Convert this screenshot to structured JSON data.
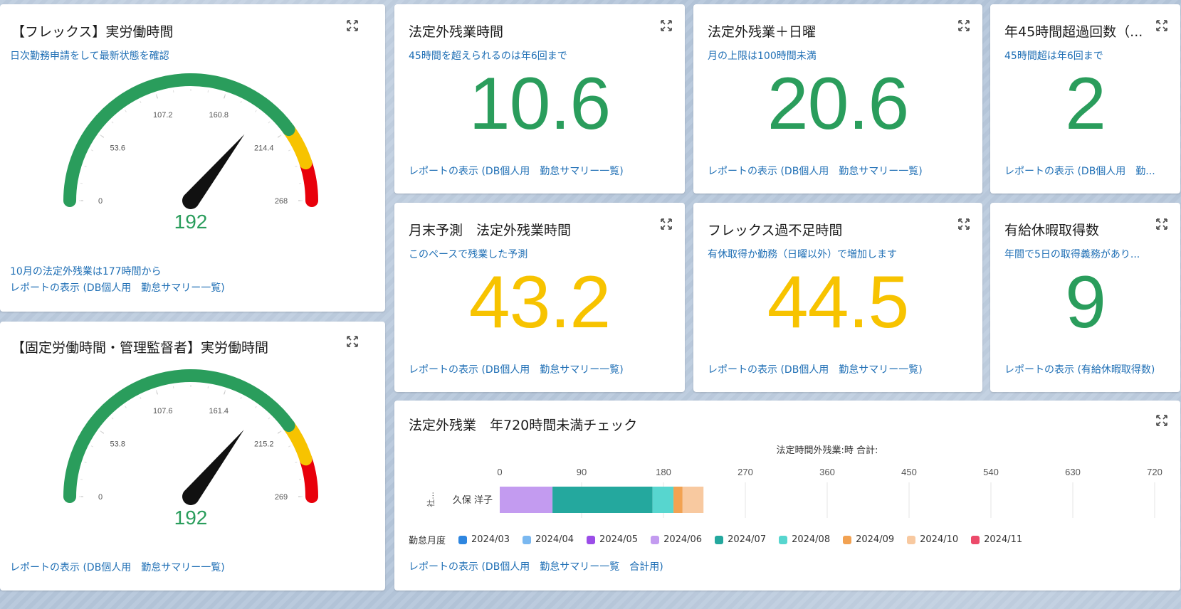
{
  "colors": {
    "green": "#2a9d5c",
    "yellow": "#f7c300",
    "red": "#e8000b",
    "link": "#1f6fb5"
  },
  "gauge1": {
    "title": "【フレックス】実労働時間",
    "subtitle": "日次勤務申請をして最新状態を確認",
    "ticks": [
      "0",
      "53.6",
      "107.2",
      "160.8",
      "214.4",
      "268"
    ],
    "value": "192",
    "value_num": 192,
    "max": 268,
    "yellow_from": 214.4,
    "red_from": 241,
    "note": "10月の法定外残業は177時間から",
    "link": "レポートの表示 (DB個人用　勤怠サマリー一覧)",
    "expand_icon": "expand-icon"
  },
  "gauge2": {
    "title": "【固定労働時間・管理監督者】実労働時間",
    "ticks": [
      "0",
      "53.8",
      "107.6",
      "161.4",
      "215.2",
      "269"
    ],
    "value": "192",
    "value_num": 192,
    "max": 269,
    "yellow_from": 215.2,
    "red_from": 242,
    "link": "レポートの表示 (DB個人用　勤怠サマリー一覧)",
    "expand_icon": "expand-icon"
  },
  "metrics": [
    {
      "title": "法定外残業時間",
      "subtitle": "45時間を超えられるのは年6回まで",
      "value": "10.6",
      "color": "#2a9d5c",
      "link": "レポートの表示 (DB個人用　勤怠サマリー一覧)"
    },
    {
      "title": "法定外残業＋日曜",
      "subtitle": "月の上限は100時間未満",
      "value": "20.6",
      "color": "#2a9d5c",
      "link": "レポートの表示 (DB個人用　勤怠サマリー一覧)"
    },
    {
      "title": "年45時間超過回数（...",
      "subtitle": "45時間超は年6回まで",
      "value": "2",
      "color": "#2a9d5c",
      "link": "レポートの表示 (DB個人用　勤..."
    },
    {
      "title": "月末予測　法定外残業時間",
      "subtitle": "このペースで残業した予測",
      "value": "43.2",
      "color": "#f7c300",
      "link": "レポートの表示 (DB個人用　勤怠サマリー一覧)"
    },
    {
      "title": "フレックス過不足時間",
      "subtitle": "有休取得か勤務（日曜以外）で増加します",
      "value": "44.5",
      "color": "#f7c300",
      "link": "レポートの表示 (DB個人用　勤怠サマリー一覧)"
    },
    {
      "title": "有給休暇取得数",
      "subtitle": "年間で5日の取得義務があり...",
      "value": "9",
      "color": "#2a9d5c",
      "link": "レポートの表示 (有給休暇取得数)"
    }
  ],
  "bar_card": {
    "title": "法定外残業　年720時間未満チェック",
    "link": "レポートの表示 (DB個人用　勤怠サマリー一覧　合計用)",
    "legend_title": "勤怠月度",
    "expand_icon": "expand-icon"
  },
  "chart_data": {
    "type": "bar",
    "orientation": "horizontal",
    "stacked": true,
    "title": "法定時間外残業:時 合計:",
    "y_axis_label": "社...",
    "categories": [
      "久保 洋子"
    ],
    "xlim": [
      0,
      720
    ],
    "x_ticks": [
      "0",
      "90",
      "180",
      "270",
      "360",
      "450",
      "540",
      "630",
      "720"
    ],
    "series": [
      {
        "name": "2024/03",
        "color": "#2e86e0",
        "values": [
          0
        ]
      },
      {
        "name": "2024/04",
        "color": "#7ab8f0",
        "values": [
          0
        ]
      },
      {
        "name": "2024/05",
        "color": "#9b4de8",
        "values": [
          0
        ]
      },
      {
        "name": "2024/06",
        "color": "#c39bf0",
        "values": [
          58
        ]
      },
      {
        "name": "2024/07",
        "color": "#24a89e",
        "values": [
          110
        ]
      },
      {
        "name": "2024/08",
        "color": "#57d6cf",
        "values": [
          23
        ]
      },
      {
        "name": "2024/09",
        "color": "#f2a252",
        "values": [
          10
        ]
      },
      {
        "name": "2024/10",
        "color": "#f8c9a0",
        "values": [
          23
        ]
      },
      {
        "name": "2024/11",
        "color": "#ec4a6a",
        "values": [
          0
        ]
      }
    ],
    "legend_position": "bottom",
    "grid": true
  }
}
